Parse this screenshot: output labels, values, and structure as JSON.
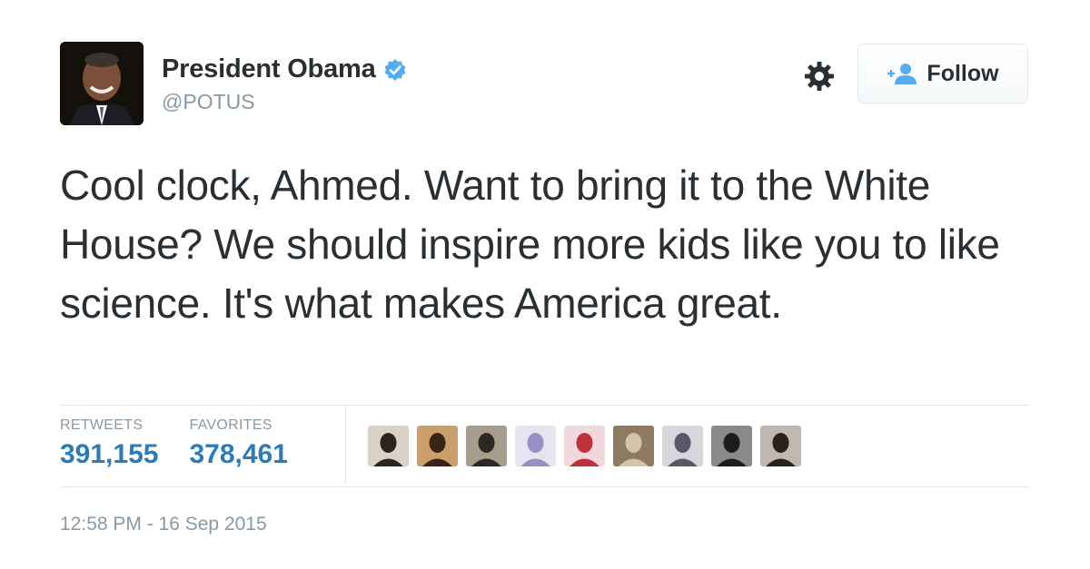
{
  "user": {
    "display_name": "President Obama",
    "handle": "@POTUS",
    "verified_icon": "verified-badge-icon"
  },
  "actions": {
    "follow_label": "Follow",
    "follow_icon": "add-user-icon",
    "settings_icon": "gear-icon"
  },
  "tweet": {
    "text": "Cool clock, Ahmed. Want to bring it to the White House? We should inspire more kids like you to like science. It's what makes America great.",
    "timestamp": "12:58 PM - 16 Sep 2015"
  },
  "stats": {
    "retweets_label": "RETWEETS",
    "retweets_count": "391,155",
    "favorites_label": "FAVORITES",
    "favorites_count": "378,461"
  },
  "favoriters": [
    {
      "bg": "#d9d2c7",
      "fg": "#2c2420"
    },
    {
      "bg": "#c9a06a",
      "fg": "#3a2418"
    },
    {
      "bg": "#a89c8c",
      "fg": "#2e2824"
    },
    {
      "bg": "#e6e4ef",
      "fg": "#9a8ec4"
    },
    {
      "bg": "#f0d8dc",
      "fg": "#c0303a"
    },
    {
      "bg": "#8e7a62",
      "fg": "#d4c4a8"
    },
    {
      "bg": "#d8d6dc",
      "fg": "#5a5868"
    },
    {
      "bg": "#8a8a8a",
      "fg": "#1c1c1c"
    },
    {
      "bg": "#c0b8b0",
      "fg": "#2a201c"
    }
  ],
  "colors": {
    "link_blue": "#2b7bb9",
    "muted_gray": "#8899a6",
    "verified_blue": "#55acee"
  }
}
